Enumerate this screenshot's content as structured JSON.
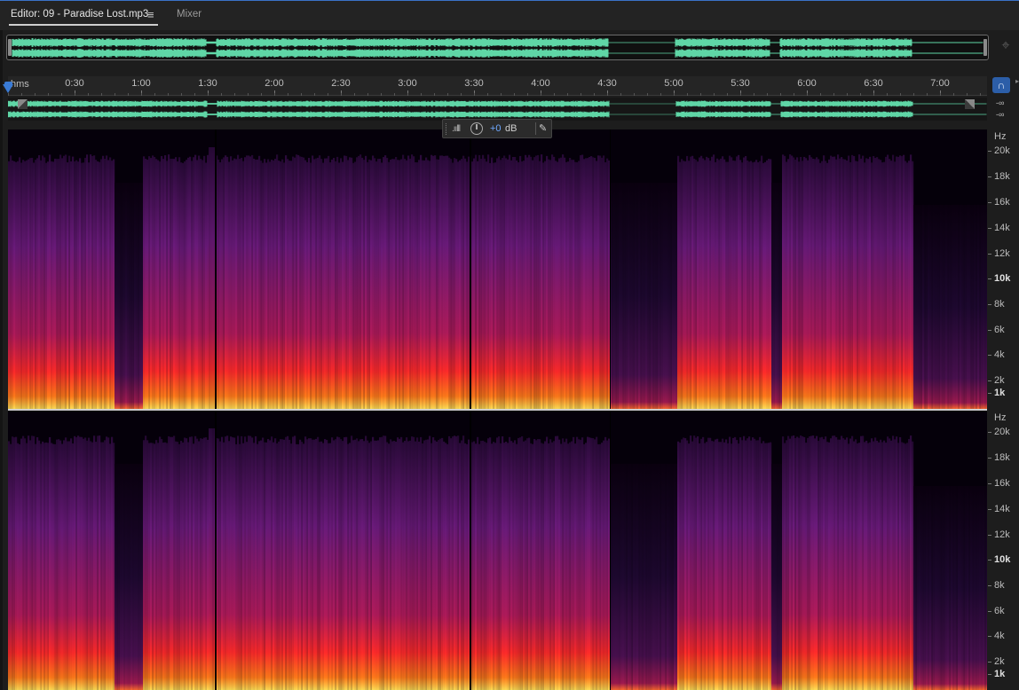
{
  "tabs": {
    "editor_label": "Editor: 09 - Paradise Lost.mp3",
    "menu_glyph": "≡",
    "mixer_label": "Mixer"
  },
  "ruler": {
    "unit": "hms",
    "labels": [
      "0:30",
      "1:00",
      "1:30",
      "2:00",
      "2:30",
      "3:00",
      "3:30",
      "4:00",
      "4:30",
      "5:00",
      "5:30",
      "6:00",
      "6:30",
      "7:00"
    ]
  },
  "mini_waveform": {
    "db_top": "-∞",
    "db_bottom": "-∞"
  },
  "hud": {
    "value": "+0",
    "unit": "dB"
  },
  "frequency_scale": {
    "unit": "Hz",
    "labels": [
      "20k",
      "18k",
      "16k",
      "14k",
      "12k",
      "10k",
      "8k",
      "6k",
      "4k",
      "2k",
      "1k"
    ]
  },
  "icons": {
    "monitor": "headphones-icon",
    "zoom_navigator": "zoom-navigator-icon",
    "pin": "pin-icon"
  },
  "colors": {
    "waveform": "#5fd6a6",
    "accent": "#3a7bd5",
    "spectrum_low": "#ffdd55",
    "spectrum_mid": "#ff2a2a",
    "spectrum_high": "#6a1a7a"
  }
}
